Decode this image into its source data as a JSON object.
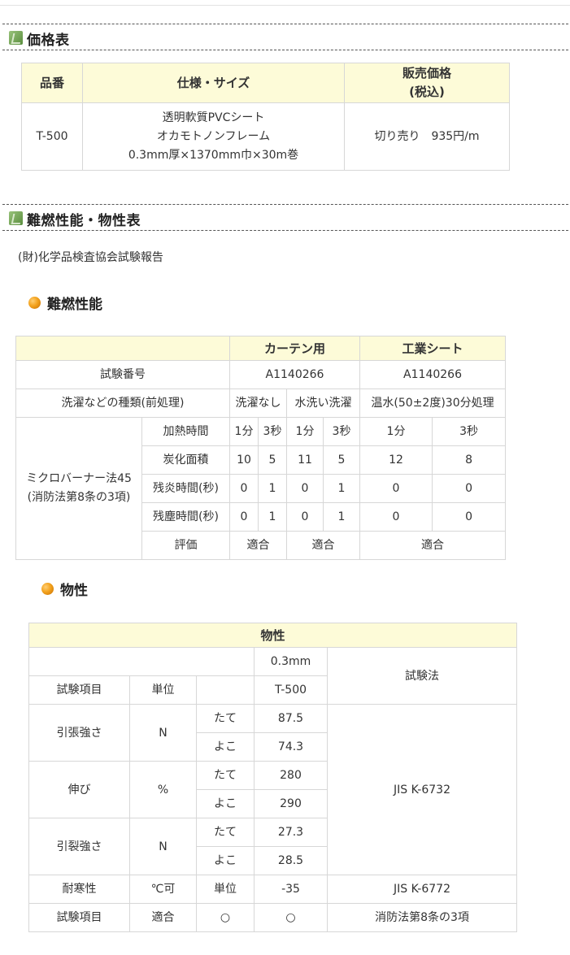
{
  "sections": {
    "price": {
      "title": "価格表"
    },
    "flame": {
      "title": "難燃性能・物性表",
      "source_note": "(財)化学品検査協会試験報告"
    }
  },
  "price_table": {
    "headers": {
      "code": "品番",
      "spec": "仕様・サイズ",
      "price_l1": "販売価格",
      "price_l2": "(税込)"
    },
    "row": {
      "code": "T-500",
      "spec_l1": "透明軟質PVCシート",
      "spec_l2": "オカモトノンフレーム",
      "spec_l3": "0.3mm厚×1370mm巾×30m巻",
      "price": "切り売り　935円/m"
    }
  },
  "flame_table": {
    "subtitle": "難燃性能",
    "col_curtain": "カーテン用",
    "col_industrial": "工業シート",
    "test_no_label": "試験番号",
    "test_no_curtain": "A1140266",
    "test_no_industrial": "A1140266",
    "pre_label": "洗濯などの種類(前処理)",
    "pre_none": "洗濯なし",
    "pre_water": "水洗い洗濯",
    "pre_hot": "温水(50±2度)30分処理",
    "method_l1": "ミクロバーナー法45",
    "method_l2": "(消防法第8条の3項)",
    "rows": {
      "heating": {
        "label": "加熱時間",
        "v": [
          "1分",
          "3秒",
          "1分",
          "3秒",
          "1分",
          "3秒"
        ]
      },
      "char": {
        "label": "炭化面積",
        "v": [
          "10",
          "5",
          "11",
          "5",
          "12",
          "8"
        ]
      },
      "afterflame": {
        "label": "残炎時間(秒)",
        "v": [
          "0",
          "1",
          "0",
          "1",
          "0",
          "0"
        ]
      },
      "afterglow": {
        "label": "残塵時間(秒)",
        "v": [
          "0",
          "1",
          "0",
          "1",
          "0",
          "0"
        ]
      }
    },
    "eval_label": "評価",
    "eval": [
      "適合",
      "適合",
      "適合"
    ]
  },
  "phys_table": {
    "subtitle": "物性",
    "title": "物性",
    "thickness": "0.3mm",
    "test_method_header": "試験法",
    "item_header": "試験項目",
    "unit_header": "単位",
    "product": "T-500",
    "tensile": {
      "label": "引張強さ",
      "unit": "N",
      "tate": "たて",
      "tate_v": "87.5",
      "yoko": "よこ",
      "yoko_v": "74.3"
    },
    "elong": {
      "label": "伸び",
      "unit": "%",
      "tate": "たて",
      "tate_v": "280",
      "yoko": "よこ",
      "yoko_v": "290"
    },
    "tear": {
      "label": "引裂強さ",
      "unit": "N",
      "tate": "たて",
      "tate_v": "27.3",
      "yoko": "よこ",
      "yoko_v": "28.5"
    },
    "jis_main": "JIS K-6732",
    "cold": {
      "label": "耐寒性",
      "unit": "℃可",
      "sub": "単位",
      "value": "-35",
      "method": "JIS K-6772"
    },
    "last": {
      "label": "試験項目",
      "unit": "適合",
      "sub": "○",
      "value": "○",
      "method": "消防法第8条の3項"
    }
  }
}
